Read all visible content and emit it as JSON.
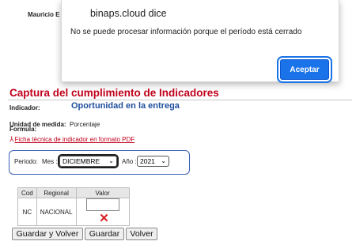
{
  "header": {
    "user_name": "Mauricio E"
  },
  "dialog": {
    "title": "binaps.cloud dice",
    "message": "No se puede procesar información porque el período está cerrado",
    "ok_label": "Aceptar"
  },
  "page": {
    "title": "Captura del cumplimiento de Indicadores",
    "indicator_label": "Indicador:",
    "indicator_value": "Oportunidad en la entrega",
    "unit_label": "Unidad de medida:",
    "unit_value": "Porcentaje",
    "formula_label": "Formula:",
    "pdf_link": "Ficha técnica de indicador en formato PDF"
  },
  "period": {
    "label": "Periodo:",
    "month_label": "Mes :",
    "month_value": "DICIEMBRE",
    "year_label": "Año :",
    "year_value": "2021"
  },
  "table": {
    "headers": [
      "Cod",
      "Regional",
      "Valor"
    ],
    "rows": [
      {
        "cod": "NC",
        "regional": "NACIONAL",
        "valor": ""
      }
    ]
  },
  "buttons": {
    "save_return": "Guardar y Volver",
    "save": "Guardar",
    "back": "Volver"
  },
  "colors": {
    "title_red": "#c0001a",
    "indicator_blue": "#1f4e9c",
    "dialog_button": "#1a73e8"
  }
}
